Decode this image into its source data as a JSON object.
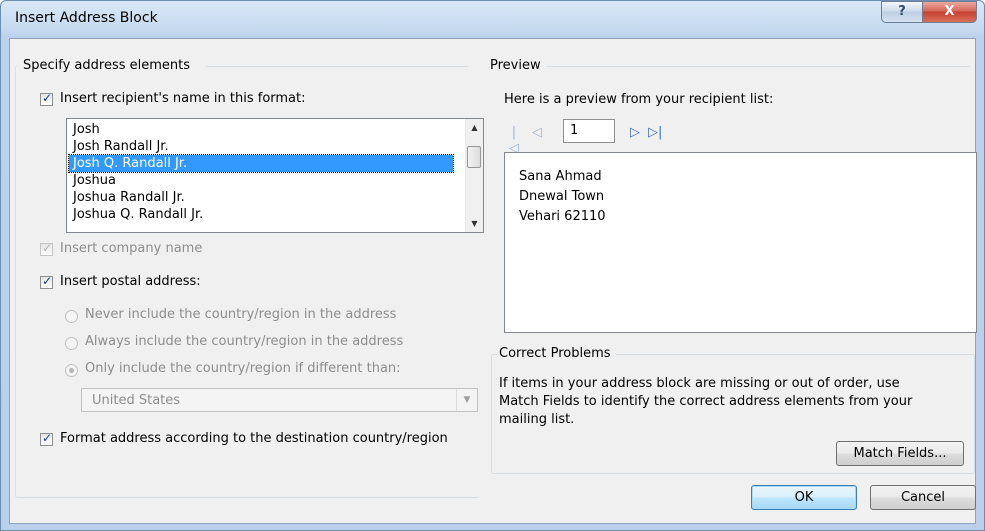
{
  "window": {
    "title": "Insert Address Block",
    "help_glyph": "?",
    "close_glyph": "X"
  },
  "left": {
    "group_label": "Specify address elements",
    "recipient_name": {
      "checked": true,
      "label": "Insert recipient's name in this format:",
      "formats": [
        "Josh",
        "Josh Randall Jr.",
        "Josh Q. Randall Jr.",
        "Joshua",
        "Joshua Randall Jr.",
        "Joshua Q. Randall Jr."
      ],
      "selected_index": 2
    },
    "company_name": {
      "checked": true,
      "enabled": false,
      "label": "Insert company name"
    },
    "postal_address": {
      "checked": true,
      "label": "Insert postal address:",
      "options": [
        {
          "label": "Never include the country/region in the address",
          "selected": false
        },
        {
          "label": "Always include the country/region in the address",
          "selected": false
        },
        {
          "label": "Only include the country/region if different than:",
          "selected": true
        }
      ],
      "country_value": "United States"
    },
    "format_by_destination": {
      "checked": true,
      "label": "Format address according to the destination country/region"
    }
  },
  "preview": {
    "group_label": "Preview",
    "intro": "Here is a preview from your recipient list:",
    "record_number": "1",
    "address_lines": [
      "Sana Ahmad",
      "Dnewal Town",
      "Vehari 62110"
    ]
  },
  "correct_problems": {
    "group_label": "Correct Problems",
    "description_lines": [
      "If items in your address block are missing or out of order, use",
      "Match Fields to identify the correct address elements from your",
      "mailing list."
    ],
    "match_fields_label": "Match Fields..."
  },
  "footer": {
    "ok_label": "OK",
    "cancel_label": "Cancel"
  },
  "icons": {
    "first": "first-record-icon",
    "previous": "previous-record-icon",
    "next": "next-record-icon",
    "last": "last-record-icon",
    "check": "checkmark-icon"
  }
}
